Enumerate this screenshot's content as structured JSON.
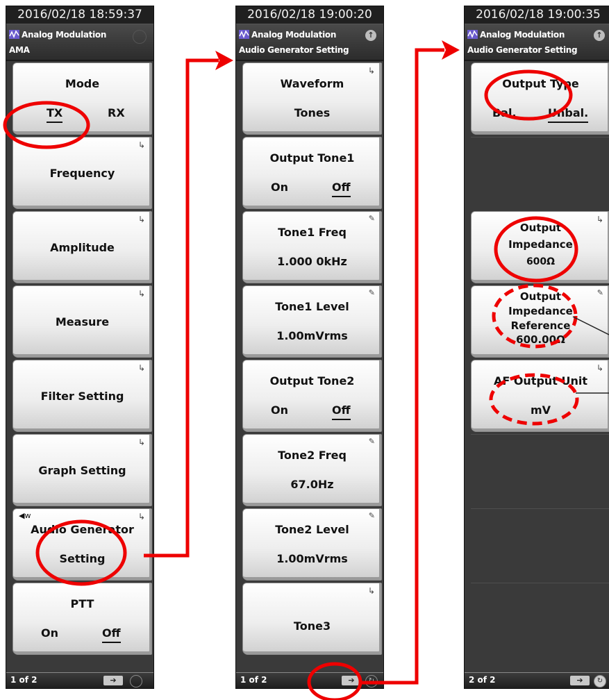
{
  "panels": [
    {
      "clock": "2016/02/18 18:59:37",
      "app": "Analog Modulation",
      "sub": "AMA",
      "keys": [
        {
          "l1": "Mode",
          "optA": "TX",
          "optB": "RX"
        },
        {
          "mid": "Frequency"
        },
        {
          "mid": "Amplitude"
        },
        {
          "mid": "Measure"
        },
        {
          "mid": "Filter Setting"
        },
        {
          "mid": "Graph Setting"
        },
        {
          "l1": "Audio Generator",
          "l2": "Setting"
        },
        {
          "l1": "PTT",
          "optA": "On",
          "optB": "Off"
        }
      ],
      "page": "1 of 2"
    },
    {
      "clock": "2016/02/18 19:00:20",
      "app": "Analog Modulation",
      "sub": "Audio Generator Setting",
      "keys": [
        {
          "l1": "Waveform",
          "l2": "Tones"
        },
        {
          "l1": "Output Tone1",
          "optA": "On",
          "optB": "Off"
        },
        {
          "l1": "Tone1 Freq",
          "l2": "1.000 0kHz"
        },
        {
          "l1": "Tone1 Level",
          "l2": "1.00mVrms"
        },
        {
          "l1": "Output Tone2",
          "optA": "On",
          "optB": "Off"
        },
        {
          "l1": "Tone2 Freq",
          "l2": "67.0Hz"
        },
        {
          "l1": "Tone2 Level",
          "l2": "1.00mVrms"
        },
        {
          "mid": "Tone3"
        }
      ],
      "page": "1 of 2"
    },
    {
      "clock": "2016/02/18 19:00:35",
      "app": "Analog Modulation",
      "sub": "Audio Generator Setting",
      "keys": [
        {
          "l1": "Output Type",
          "optA": "Bal.",
          "optB": "Unbal."
        },
        {
          "l1": "Output",
          "l2": "Impedance",
          "l3": "600Ω"
        },
        {
          "l1": "Output",
          "l2": "Impedance",
          "l3": "Reference",
          "l4": "600.00Ω"
        },
        {
          "l1": "AF Output Unit",
          "l2": "mV"
        }
      ],
      "page": "2 of 2"
    }
  ],
  "annotation": {
    "color": "#ee0000"
  }
}
